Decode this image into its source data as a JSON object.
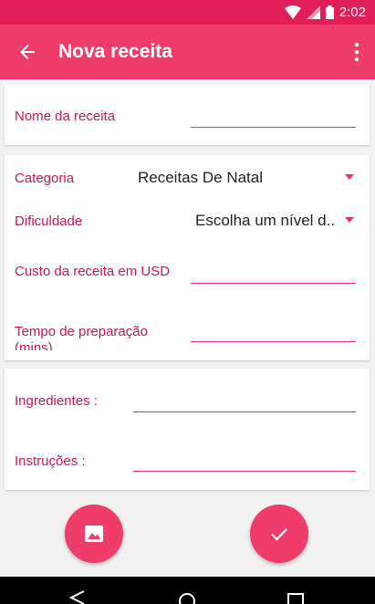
{
  "status_bar": {
    "time": "2:02"
  },
  "app_bar": {
    "title": "Nova receita",
    "back_icon": "arrow-back-icon",
    "menu_icon": "more-vert-icon"
  },
  "form": {
    "recipe_name": {
      "label": "Nome da receita",
      "value": ""
    },
    "category": {
      "label": "Categoria",
      "selected": "Receitas De Natal"
    },
    "difficulty": {
      "label": "Dificuldade",
      "selected": "Escolha um nível d.."
    },
    "cost": {
      "label": "Custo da receita em USD",
      "value": ""
    },
    "prep_time": {
      "label_line1": "Tempo de preparação",
      "label_line2": "(mins)",
      "value": ""
    },
    "ingredients": {
      "label": "Ingredientes :",
      "value": ""
    },
    "instructions": {
      "label": "Instruções :",
      "value": ""
    }
  },
  "actions": {
    "add_image_icon": "image-icon",
    "save_icon": "check-icon"
  },
  "navigation": {
    "back_icon": "nav-back-icon",
    "home_icon": "nav-home-icon",
    "recents_icon": "nav-recents-icon"
  },
  "colors": {
    "primary": "#f03c6a",
    "primary_dark": "#e01e58",
    "accent": "#c8174e"
  }
}
